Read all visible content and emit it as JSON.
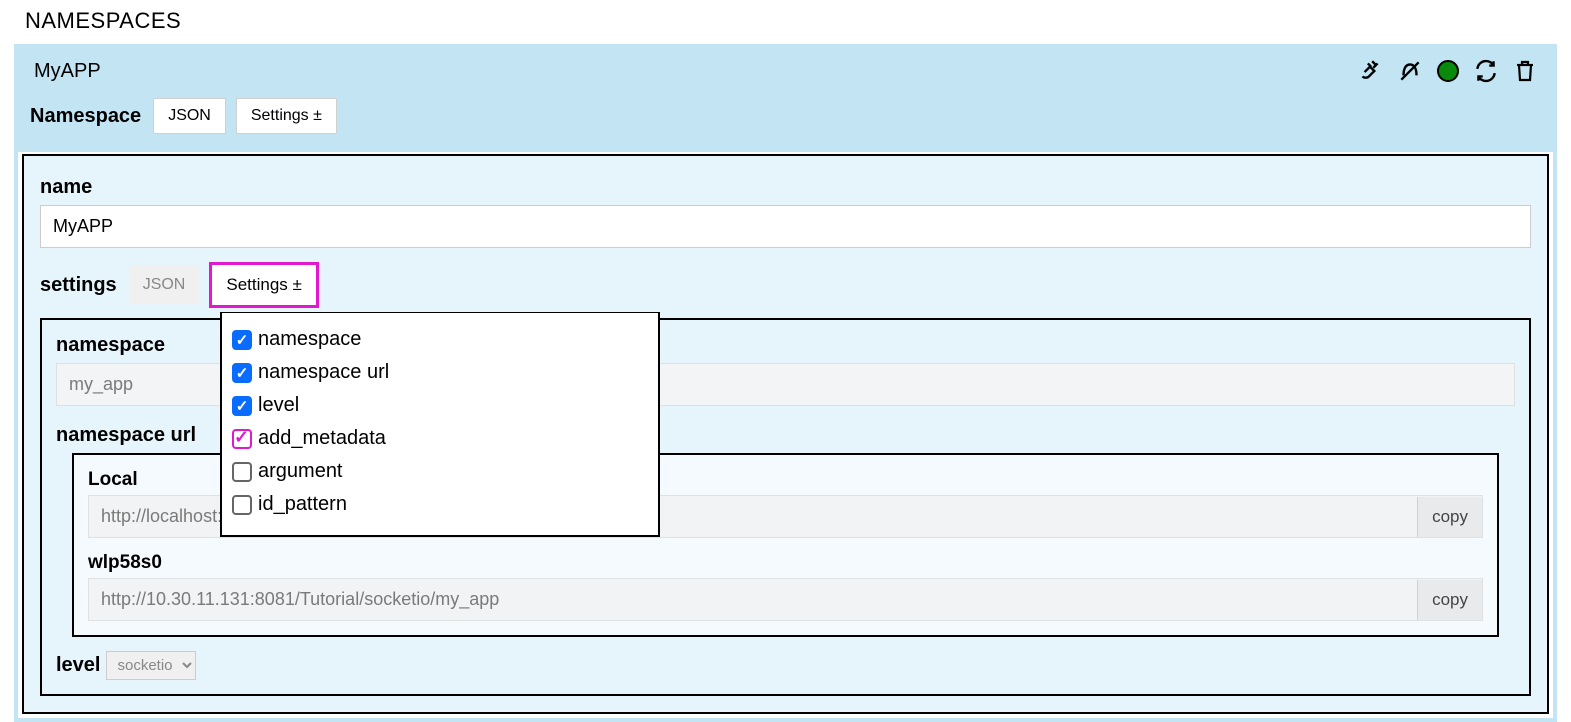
{
  "page_title": "NAMESPACES",
  "app_name": "MyAPP",
  "namespace_row": {
    "label": "Namespace",
    "json_btn": "JSON",
    "settings_btn": "Settings ±"
  },
  "form": {
    "name_label": "name",
    "name_value": "MyAPP",
    "settings_label": "settings",
    "settings_json_btn": "JSON",
    "settings_settings_btn": "Settings ±",
    "dropdown_items": [
      {
        "label": "namespace",
        "checked": true
      },
      {
        "label": "namespace url",
        "checked": true
      },
      {
        "label": "level",
        "checked": true
      },
      {
        "label": "add_metadata",
        "magenta": true
      },
      {
        "label": "argument",
        "checked": false
      },
      {
        "label": "id_pattern",
        "checked": false
      }
    ],
    "inner": {
      "namespace_label": "namespace",
      "namespace_value": "my_app",
      "namespace_url_label": "namespace url",
      "urls": [
        {
          "title": "Local",
          "value": "http://localhost:",
          "copy": "copy"
        },
        {
          "title": "wlp58s0",
          "value": "http://10.30.11.131:8081/Tutorial/socketio/my_app",
          "copy": "copy"
        }
      ],
      "level_label": "level",
      "level_value": "socketio"
    }
  }
}
